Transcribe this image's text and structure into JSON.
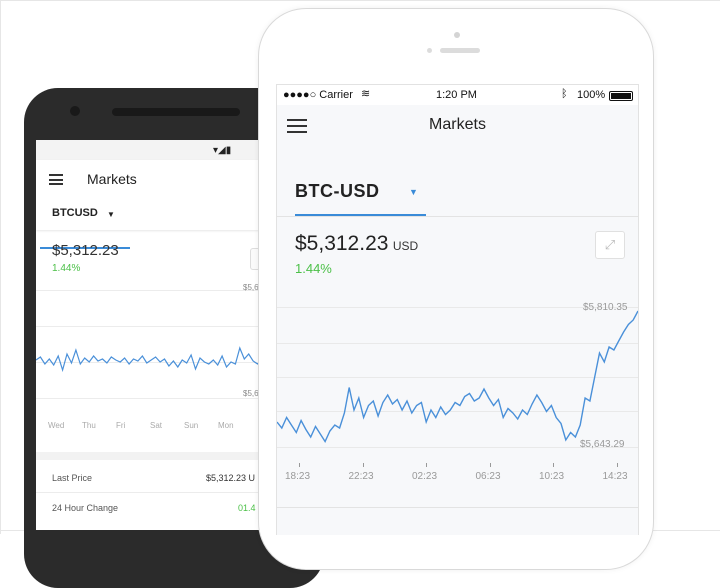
{
  "android": {
    "screen_title": "Markets",
    "tab_label": "BTCUSD",
    "price": "$5,312.23",
    "change": "1.44%",
    "y_high": "$5,6",
    "y_low": "$5,6",
    "days": [
      "Wed",
      "Thu",
      "Fri",
      "Sat",
      "Sun",
      "Mon"
    ],
    "rows": [
      {
        "label": "Last Price",
        "value": "$5,312.23 U"
      },
      {
        "label": "24 Hour Change",
        "value": "01.4"
      }
    ],
    "series": [
      0.4,
      0.43,
      0.36,
      0.41,
      0.35,
      0.44,
      0.3,
      0.46,
      0.37,
      0.5,
      0.36,
      0.42,
      0.38,
      0.44,
      0.39,
      0.41,
      0.37,
      0.43,
      0.4,
      0.38,
      0.42,
      0.36,
      0.41,
      0.39,
      0.44,
      0.37,
      0.4,
      0.43,
      0.38,
      0.41,
      0.34,
      0.39,
      0.33,
      0.4,
      0.37,
      0.45,
      0.31,
      0.42,
      0.38,
      0.36,
      0.4,
      0.35,
      0.44,
      0.33,
      0.38,
      0.36,
      0.52,
      0.41,
      0.46,
      0.39,
      0.36,
      0.4
    ]
  },
  "iphone": {
    "status": {
      "carrier": "●●●●○ Carrier",
      "time": "1:20 PM",
      "battery": "100%"
    },
    "screen_title": "Markets",
    "pair": "BTC-USD",
    "price": "$5,312.23",
    "currency": "USD",
    "change": "1.44%",
    "high_label": "$5,810.35",
    "low_label": "$5,643.29",
    "x_labels": [
      "18:23",
      "22:23",
      "02:23",
      "06:23",
      "10:23",
      "14:23"
    ],
    "series": [
      0.22,
      0.18,
      0.25,
      0.2,
      0.15,
      0.23,
      0.17,
      0.12,
      0.19,
      0.14,
      0.09,
      0.16,
      0.2,
      0.18,
      0.28,
      0.45,
      0.3,
      0.38,
      0.25,
      0.33,
      0.36,
      0.26,
      0.35,
      0.4,
      0.34,
      0.37,
      0.3,
      0.36,
      0.28,
      0.33,
      0.35,
      0.22,
      0.3,
      0.25,
      0.32,
      0.27,
      0.3,
      0.35,
      0.33,
      0.39,
      0.41,
      0.36,
      0.38,
      0.44,
      0.38,
      0.33,
      0.37,
      0.25,
      0.31,
      0.28,
      0.24,
      0.3,
      0.27,
      0.34,
      0.4,
      0.35,
      0.29,
      0.33,
      0.25,
      0.21,
      0.1,
      0.15,
      0.12,
      0.2,
      0.38,
      0.36,
      0.52,
      0.68,
      0.62,
      0.72,
      0.7,
      0.76,
      0.82,
      0.87,
      0.9,
      0.96
    ]
  },
  "colors": {
    "line": "#4a90d9",
    "positive": "#4cc048",
    "accent": "#3a8bd8"
  }
}
